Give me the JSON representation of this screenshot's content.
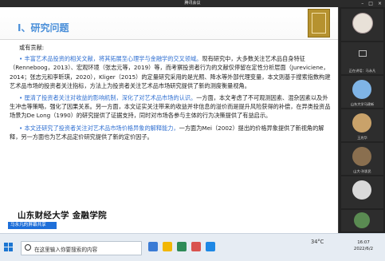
{
  "window": {
    "title": "腾讯会议"
  },
  "slide": {
    "title": "Ⅰ、研究问题",
    "intro": "或有贡献:",
    "paragraphs": [
      {
        "highlight": "丰富艺术品投资的相关文献，将其拓展至心理学与金融学的交叉领域。",
        "text": "现有研究中，大多数关注艺术品自身特征（Renneboog，2013）、宏观环境（张志元等，2019）等，而考察投资者行为的文献仅停留在定性分析层面（Jureviciene，2014；张志元和李昕琪，2020），Kliger（2015）的定量研究采用的是光照、降水等外部代理变量，本文则基于搜索指数构建艺术品市场的投资者关注指标，方法上为投资者关注艺术品市场研究提供了新的测度衡量视角。"
      },
      {
        "highlight": "厘清了投资者关注对收益的影响机制，深化了对艺术品市场的认识。",
        "text": "一方面，本文考虑了不可观测因素、混杂因素以及外生冲击等策略，强化了因果关系。另一方面，本文证实关注带来的收益并非信息的溢价而是提升风险获得的补偿，在异类投资品场景为De Long（1990）的研究提供了证据支持，同时对市场各参与主体的行为决策提供了有益启示。"
      },
      {
        "highlight": "本文还研究了投资者关注对艺术品市场价格异象的解释能力，",
        "text": "一方面为Mei（2002）提出的价格异象提供了新视角的解释，另一方面也为艺术品定价研究提供了新的定价因子。"
      }
    ],
    "logo_text": "山东财经大学 金融学院"
  },
  "share_bar": {
    "label": "马永凡的屏幕共享"
  },
  "participants": [
    {
      "name": ""
    },
    {
      "name": "正在讲话：马永凡"
    },
    {
      "name": "山东大学马建新"
    },
    {
      "name": "王兆华"
    },
    {
      "name": "山大-孙凯民"
    },
    {
      "name": ""
    },
    {
      "name": ""
    }
  ],
  "taskbar": {
    "search_placeholder": "在这里输入你要搜索的内容",
    "tray_temp": "34°C",
    "clock_time": "16:07",
    "clock_date": "2022/6/2"
  }
}
